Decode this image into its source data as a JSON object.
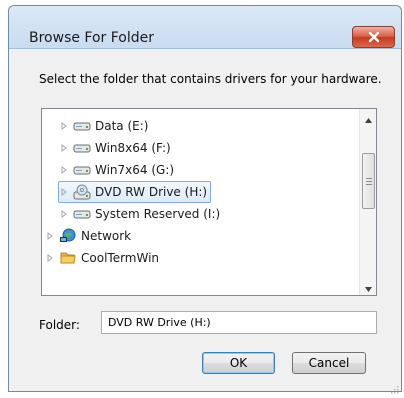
{
  "window": {
    "title": "Browse For Folder",
    "close_icon": "close-icon"
  },
  "instruction": "Select the folder that contains drivers for your hardware.",
  "tree": {
    "items": [
      {
        "label": "Data (E:)",
        "icon": "drive-icon",
        "selected": false
      },
      {
        "label": "Win8x64 (F:)",
        "icon": "drive-icon",
        "selected": false
      },
      {
        "label": "Win7x64 (G:)",
        "icon": "drive-icon",
        "selected": false
      },
      {
        "label": "DVD RW Drive (H:)",
        "icon": "dvd-drive-icon",
        "selected": true
      },
      {
        "label": "System Reserved (I:)",
        "icon": "drive-icon",
        "selected": false
      },
      {
        "label": "Network",
        "icon": "network-icon",
        "selected": false
      },
      {
        "label": "CoolTermWin",
        "icon": "folder-icon",
        "selected": false
      }
    ]
  },
  "folder_field": {
    "label": "Folder:",
    "value": "DVD RW Drive (H:)"
  },
  "buttons": {
    "ok": "OK",
    "cancel": "Cancel"
  },
  "colors": {
    "selection_border": "#84acdd",
    "close_button": "#c9442a",
    "default_button_border": "#3c7fb1"
  }
}
